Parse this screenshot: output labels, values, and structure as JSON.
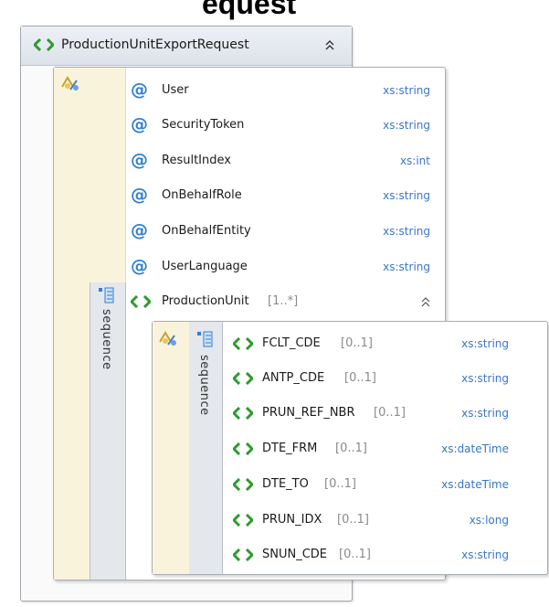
{
  "heading_fragment": "equest",
  "root": {
    "name": "ProductionUnitExportRequest",
    "collapse_icon": "double-chevron-up-icon"
  },
  "attributes": [
    {
      "name": "User",
      "type": "xs:string"
    },
    {
      "name": "SecurityToken",
      "type": "xs:string"
    },
    {
      "name": "ResultIndex",
      "type": "xs:int"
    },
    {
      "name": "OnBehalfRole",
      "type": "xs:string"
    },
    {
      "name": "OnBehalfEntity",
      "type": "xs:string"
    },
    {
      "name": "UserLanguage",
      "type": "xs:string"
    }
  ],
  "sequence_label": "sequence",
  "production_unit": {
    "name": "ProductionUnit",
    "cardinality": "[1..*]"
  },
  "children": [
    {
      "name": "FCLT_CDE",
      "cardinality": "[0..1]",
      "type": "xs:string"
    },
    {
      "name": "ANTP_CDE",
      "cardinality": "[0..1]",
      "type": "xs:string"
    },
    {
      "name": "PRUN_REF_NBR",
      "cardinality": "[0..1]",
      "type": "xs:string"
    },
    {
      "name": "DTE_FRM",
      "cardinality": "[0..1]",
      "type": "xs:dateTime"
    },
    {
      "name": "DTE_TO",
      "cardinality": "[0..1]",
      "type": "xs:dateTime"
    },
    {
      "name": "PRUN_IDX",
      "cardinality": "[0..1]",
      "type": "xs:long"
    },
    {
      "name": "SNUN_CDE",
      "cardinality": "[0..1]",
      "type": "xs:string"
    }
  ],
  "colors": {
    "element_icon": "#2e9a2e",
    "attribute_icon": "#2f7fd4",
    "type_text": "#3a76c9",
    "strip": "#faf3dc",
    "sequence_bar": "#e4e7ec"
  }
}
